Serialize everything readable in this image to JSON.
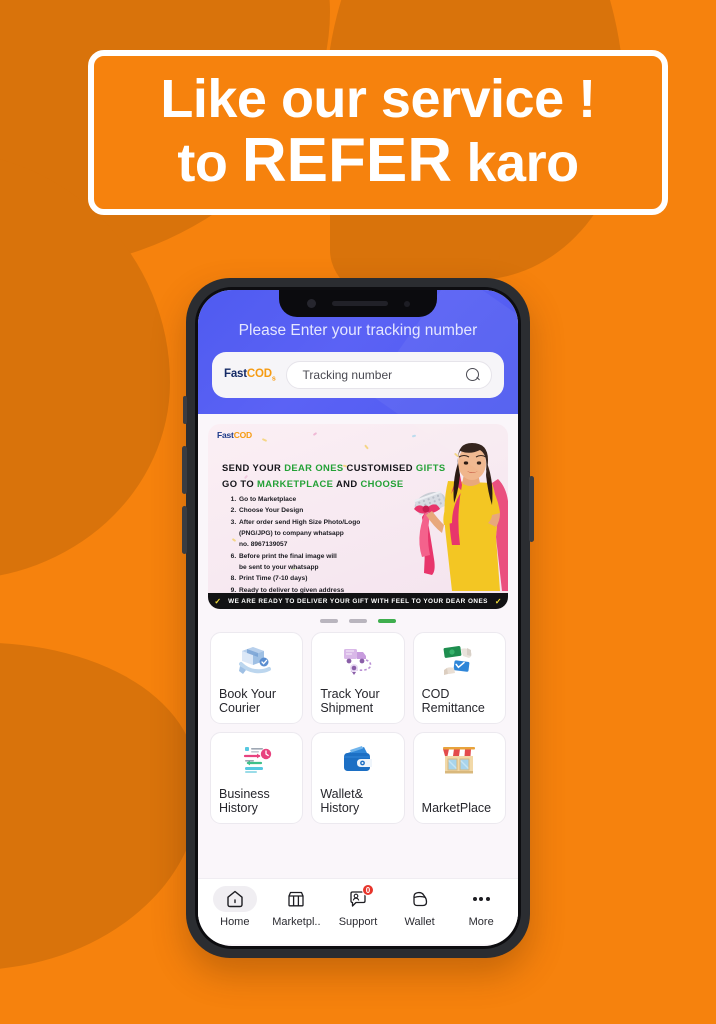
{
  "promo_banner": {
    "line1": "Like our service !",
    "line2_prefix": "to ",
    "line2_emphasis": "REFER",
    "line2_suffix": " karo",
    "border_color": "#FFFFFF",
    "background_color": "#F6820D"
  },
  "app": {
    "header": {
      "prompt": "Please Enter your tracking number",
      "background_color": "#4F5BF0",
      "logo": {
        "part1": "Fast",
        "part2": "COD",
        "subscript": "s"
      },
      "search": {
        "placeholder": "Tracking number",
        "value": "",
        "icon": "search-icon"
      }
    },
    "carousel": {
      "slide": {
        "logo": {
          "part1": "Fast",
          "part2": "COD"
        },
        "headline_line1_a": "SEND YOUR ",
        "headline_line1_hl1": "DEAR ONES",
        "headline_line1_b": " CUSTOMISED ",
        "headline_line1_hl2": "GIFTS",
        "headline_line2_a": "GO TO ",
        "headline_line2_hl": "MARKETPLACE",
        "headline_line2_b": " AND ",
        "headline_line2_hl2": "CHOOSE",
        "steps": [
          "Go to Marketplace",
          "Choose Your Design",
          "After order send High Size Photo/Logo",
          "(PNG/JPG) to company whatsapp",
          "no. 8967139057",
          "Before print the final image will",
          "be sent to your whatsapp",
          "Print Time (7-10 days)",
          "Ready to deliver to given address"
        ],
        "footer_text": "WE ARE READY TO DELIVER YOUR GIFT WITH FEEL TO YOUR DEAR ONES",
        "highlight_color": "#23A136"
      },
      "dots": [
        {
          "active": false
        },
        {
          "active": false
        },
        {
          "active": true
        }
      ],
      "active_dot_color": "#3FAE4E"
    },
    "services": [
      {
        "label": "Book Your Courier",
        "icon": "hand-parcel-icon"
      },
      {
        "label": "Track Your Shipment",
        "icon": "delivery-truck-route-icon"
      },
      {
        "label": "COD Remittance",
        "icon": "cash-exchange-icon"
      },
      {
        "label": "Business History",
        "icon": "transfer-history-icon"
      },
      {
        "label": "Wallet& History",
        "icon": "wallet-icon"
      },
      {
        "label": "MarketPlace",
        "icon": "storefront-icon"
      }
    ],
    "bottom_nav": [
      {
        "label": "Home",
        "icon": "home-icon",
        "active": true,
        "badge": ""
      },
      {
        "label": "Marketpl..",
        "icon": "store-icon",
        "active": false,
        "badge": ""
      },
      {
        "label": "Support",
        "icon": "support-chat-icon",
        "active": false,
        "badge": "0"
      },
      {
        "label": "Wallet",
        "icon": "wallet-nav-icon",
        "active": false,
        "badge": ""
      },
      {
        "label": "More",
        "icon": "more-dots-icon",
        "active": false,
        "badge": ""
      }
    ],
    "badge_color": "#E7352B"
  }
}
